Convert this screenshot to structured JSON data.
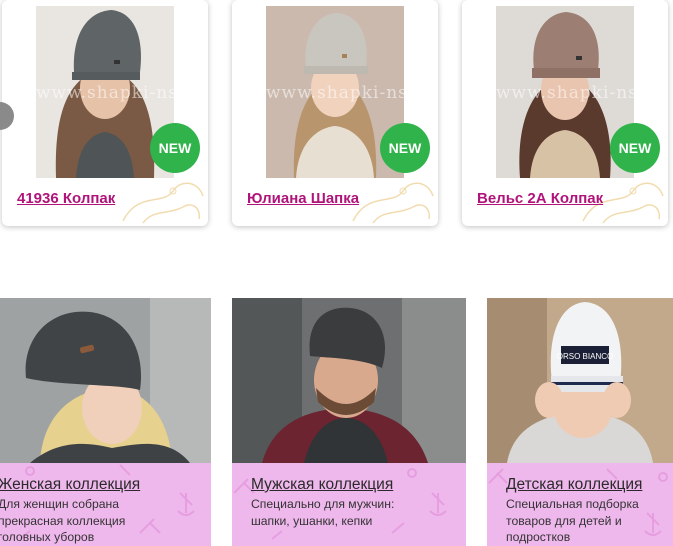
{
  "products": [
    {
      "title": "41936 Колпак",
      "badge": "NEW",
      "watermark": "www.shapki-nsk.ru",
      "hat_color": "#5f6466"
    },
    {
      "title": "Юлиана Шапка",
      "badge": "NEW",
      "watermark": "www.shapki-nsk.ru",
      "hat_color": "#c9c6bf"
    },
    {
      "title": "Вельс 2А Колпак",
      "badge": "NEW",
      "watermark": "www.shapki-nsk.ru",
      "hat_color": "#9c7e72"
    }
  ],
  "collections": [
    {
      "title": "Женская коллекция",
      "description": [
        "Для женщин собрана",
        "прекрасная коллекция",
        "головных уборов"
      ]
    },
    {
      "title": "Мужская коллекция",
      "description": [
        "Специально для мужчин:",
        "шапки, ушанки, кепки"
      ]
    },
    {
      "title": "Детская коллекция",
      "description": [
        "Специальная подборка",
        "товаров для детей и",
        "подростков"
      ]
    }
  ],
  "children_hat_label": "ORSO BIANCO",
  "colors": {
    "badge": "#2fb34a",
    "product_title": "#b0147a",
    "collection_box": "#efb8ec"
  }
}
